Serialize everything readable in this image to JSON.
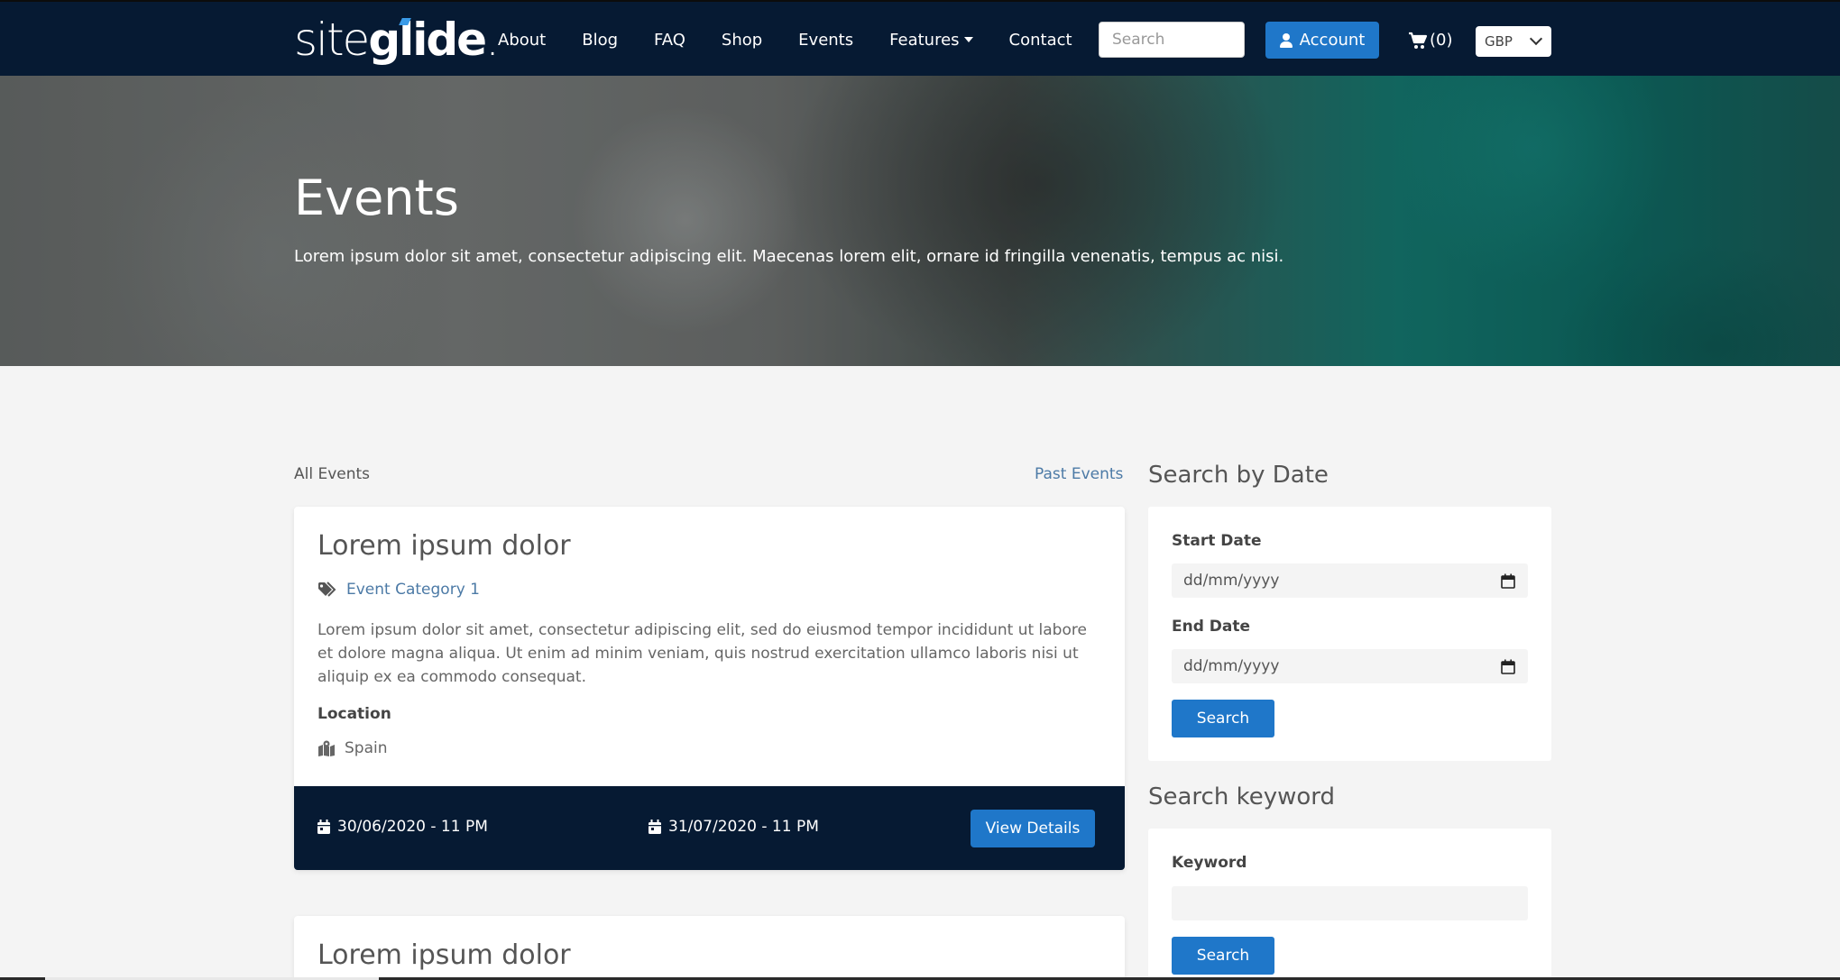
{
  "nav": {
    "logo_light": "site",
    "logo_bold": "glide",
    "logo_suffix": ".",
    "links": [
      "About",
      "Blog",
      "FAQ",
      "Shop",
      "Events",
      "Features",
      "Contact"
    ],
    "search_placeholder": "Search",
    "account_label": "Account",
    "cart_label": "(0)",
    "currency": "GBP"
  },
  "hero": {
    "title": "Events",
    "text": "Lorem ipsum dolor sit amet, consectetur adipiscing elit. Maecenas lorem elit, ornare id fringilla venenatis, tempus ac nisi."
  },
  "list": {
    "all_label": "All Events",
    "past_label": "Past Events"
  },
  "events": [
    {
      "title": "Lorem ipsum dolor",
      "category": "Event Category 1",
      "description": "Lorem ipsum dolor sit amet, consectetur adipiscing elit, sed do eiusmod tempor incididunt ut labore et dolore magna aliqua. Ut enim ad minim veniam, quis nostrud exercitation ullamco laboris nisi ut aliquip ex ea commodo consequat.",
      "location_label": "Location",
      "location": "Spain",
      "start": "30/06/2020 - 11 PM",
      "end": "31/07/2020 - 11 PM",
      "button": "View Details"
    },
    {
      "title": "Lorem ipsum dolor"
    }
  ],
  "sidebar": {
    "date_title": "Search by Date",
    "start_label": "Start Date",
    "start_placeholder": "dd/mm/yyyy",
    "end_label": "End Date",
    "end_placeholder": "dd/mm/yyyy",
    "date_search_button": "Search",
    "keyword_title": "Search keyword",
    "keyword_label": "Keyword",
    "keyword_value": "",
    "keyword_search_button": "Search"
  },
  "colors": {
    "navbar": "#061a33",
    "accent": "#1f77c9",
    "link": "#4c7aa6",
    "page_bg": "#f4f4f4"
  }
}
